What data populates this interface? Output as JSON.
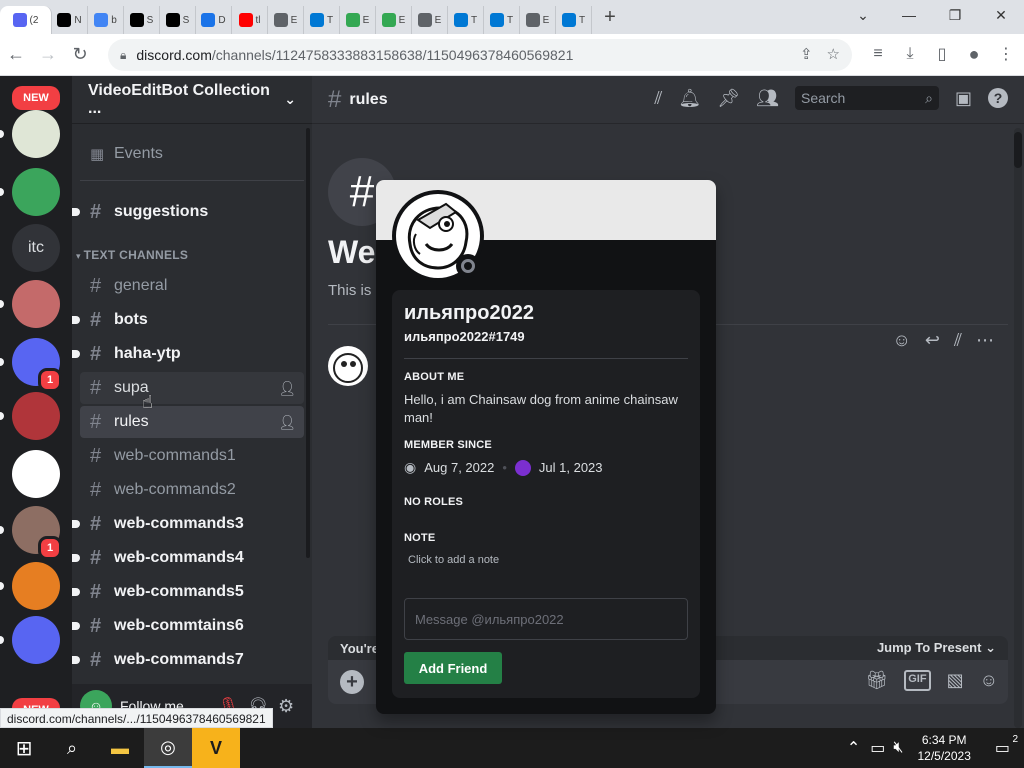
{
  "browser": {
    "tabs": [
      {
        "label": "(2",
        "icon": "discord-icon",
        "color": "#5865f2",
        "active": true
      },
      {
        "label": "N",
        "icon": "notion-icon",
        "color": "#000000"
      },
      {
        "label": "b",
        "icon": "google-icon",
        "color": "#4285f4"
      },
      {
        "label": "S",
        "icon": "s-icon",
        "color": "#000000"
      },
      {
        "label": "S",
        "icon": "s-icon",
        "color": "#000000"
      },
      {
        "label": "D",
        "icon": "download-icon",
        "color": "#1a73e8"
      },
      {
        "label": "tl",
        "icon": "youtube-icon",
        "color": "#ff0000"
      },
      {
        "label": "E",
        "icon": "globe-icon",
        "color": "#5f6368"
      },
      {
        "label": "T",
        "icon": "edge-icon",
        "color": "#0078d4"
      },
      {
        "label": "E",
        "icon": "drive-icon",
        "color": "#34a853"
      },
      {
        "label": "E",
        "icon": "drive-icon",
        "color": "#34a853"
      },
      {
        "label": "E",
        "icon": "globe-icon",
        "color": "#5f6368"
      },
      {
        "label": "T",
        "icon": "edge-icon",
        "color": "#0078d4"
      },
      {
        "label": "T",
        "icon": "edge-icon",
        "color": "#0078d4"
      },
      {
        "label": "E",
        "icon": "globe-icon",
        "color": "#5f6368"
      },
      {
        "label": "T",
        "icon": "edge-icon",
        "color": "#0078d4"
      }
    ],
    "url_domain": "discord.com",
    "url_path": "/channels/1124758333883158638/1150496378460569821",
    "status_url": "discord.com/channels/.../1150496378460569821"
  },
  "discord": {
    "server_name": "VideoEditBot Collection ...",
    "events_label": "Events",
    "category": "TEXT CHANNELS",
    "channels": [
      {
        "name": "suggestions",
        "state": "unread",
        "dot": true
      },
      {
        "name": "general",
        "state": "muted"
      },
      {
        "name": "bots",
        "state": "unread",
        "dot": true
      },
      {
        "name": "haha-ytp",
        "state": "unread",
        "dot": true
      },
      {
        "name": "supa",
        "state": "hover"
      },
      {
        "name": "rules",
        "state": "selected"
      },
      {
        "name": "web-commands1",
        "state": "muted"
      },
      {
        "name": "web-commands2",
        "state": "muted"
      },
      {
        "name": "web-commands3",
        "state": "unread",
        "dot": true
      },
      {
        "name": "web-commands4",
        "state": "unread",
        "dot": true
      },
      {
        "name": "web-commands5",
        "state": "unread",
        "dot": true
      },
      {
        "name": "web-commtains6",
        "state": "unread",
        "dot": true
      },
      {
        "name": "web-commands7",
        "state": "unread",
        "dot": true
      }
    ],
    "user_panel": "Follow me",
    "servers": [
      {
        "label": "NEW",
        "kind": "new"
      },
      {
        "label": "",
        "kind": "img",
        "color": "#dfe6d6"
      },
      {
        "label": "",
        "kind": "img",
        "color": "#3ba55c"
      },
      {
        "label": "itc",
        "kind": "text"
      },
      {
        "label": "",
        "kind": "img",
        "color": "#c46a6a"
      },
      {
        "label": "",
        "kind": "img",
        "color": "#5865f2",
        "badge": "1"
      },
      {
        "label": "",
        "kind": "img",
        "color": "#b0353a"
      },
      {
        "label": "",
        "kind": "img",
        "color": "#ffffff"
      },
      {
        "label": "",
        "kind": "img",
        "color": "#8d6e63",
        "badge": "1"
      },
      {
        "label": "",
        "kind": "img",
        "color": "#e67e22"
      },
      {
        "label": "",
        "kind": "img",
        "color": "#5865f2"
      },
      {
        "label": "NEW",
        "kind": "new"
      }
    ],
    "channel_header": "rules",
    "search_placeholder": "Search",
    "welcome_title": "Wel",
    "welcome_sub": "This is",
    "jump_left": "You're",
    "jump_right": "Jump To Present"
  },
  "profile": {
    "display_name": "ильяпро2022",
    "tag": "ильяпро2022#1749",
    "about_title": "ABOUT ME",
    "about_text": "Hello, i am Chainsaw dog from anime chainsaw man!",
    "member_since_title": "MEMBER SINCE",
    "discord_since": "Aug 7, 2022",
    "server_since": "Jul 1, 2023",
    "roles_title": "NO ROLES",
    "note_title": "NOTE",
    "note_placeholder": "Click to add a note",
    "message_placeholder": "Message @ильяпро2022",
    "add_friend": "Add Friend"
  },
  "taskbar": {
    "time": "6:34 PM",
    "date": "12/5/2023",
    "notification_count": "2"
  }
}
